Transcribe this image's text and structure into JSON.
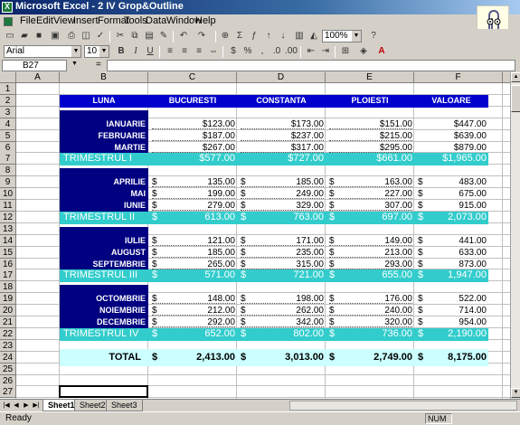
{
  "window": {
    "title": "Microsoft Excel - 2 IV Grop&Outline"
  },
  "menu": [
    "File",
    "Edit",
    "View",
    "Insert",
    "Format",
    "Tools",
    "Data",
    "Window",
    "Help"
  ],
  "toolbar": {
    "zoom": "100%",
    "font": "Arial",
    "size": "10"
  },
  "formula": {
    "namebox": "B27",
    "value": ""
  },
  "columns": [
    "A",
    "B",
    "C",
    "D",
    "E",
    "F",
    "G"
  ],
  "rows": [
    "1",
    "2",
    "3",
    "4",
    "5",
    "6",
    "7",
    "8",
    "9",
    "10",
    "11",
    "12",
    "13",
    "14",
    "15",
    "16",
    "17",
    "18",
    "19",
    "20",
    "21",
    "22",
    "23",
    "24",
    "25",
    "26",
    "27"
  ],
  "header": {
    "luna": "LUNA",
    "c": "BUCURESTI",
    "d": "CONSTANTA",
    "e": "PLOIESTI",
    "f": "VALOARE"
  },
  "q1": {
    "months": [
      {
        "name": "IANUARIE",
        "c": "$123.00",
        "d": "$173.00",
        "e": "$151.00",
        "f": "$447.00"
      },
      {
        "name": "FEBRUARIE",
        "c": "$187.00",
        "d": "$237.00",
        "e": "$215.00",
        "f": "$639.00"
      },
      {
        "name": "MARTIE",
        "c": "$267.00",
        "d": "$317.00",
        "e": "$295.00",
        "f": "$879.00"
      }
    ],
    "label": "TRIMESTRUL  I",
    "c": "$577.00",
    "d": "$727.00",
    "e": "$661.00",
    "f": "$1,965.00"
  },
  "q2": {
    "months": [
      {
        "name": "APRILIE",
        "c": "135.00",
        "d": "185.00",
        "e": "163.00",
        "f": "483.00"
      },
      {
        "name": "MAI",
        "c": "199.00",
        "d": "249.00",
        "e": "227.00",
        "f": "675.00"
      },
      {
        "name": "IUNIE",
        "c": "279.00",
        "d": "329.00",
        "e": "307.00",
        "f": "915.00"
      }
    ],
    "label": "TRIMESTRUL  II",
    "c": "613.00",
    "d": "763.00",
    "e": "697.00",
    "f": "2,073.00"
  },
  "q3": {
    "months": [
      {
        "name": "IULIE",
        "c": "121.00",
        "d": "171.00",
        "e": "149.00",
        "f": "441.00"
      },
      {
        "name": "AUGUST",
        "c": "185.00",
        "d": "235.00",
        "e": "213.00",
        "f": "633.00"
      },
      {
        "name": "SEPTEMBRIE",
        "c": "265.00",
        "d": "315.00",
        "e": "293.00",
        "f": "873.00"
      }
    ],
    "label": "TRIMESTRUL  III",
    "c": "571.00",
    "d": "721.00",
    "e": "655.00",
    "f": "1,947.00"
  },
  "q4": {
    "months": [
      {
        "name": "OCTOMBRIE",
        "c": "148.00",
        "d": "198.00",
        "e": "176.00",
        "f": "522.00"
      },
      {
        "name": "NOIEMBRIE",
        "c": "212.00",
        "d": "262.00",
        "e": "240.00",
        "f": "714.00"
      },
      {
        "name": "DECEMBRIE",
        "c": "292.00",
        "d": "342.00",
        "e": "320.00",
        "f": "954.00"
      }
    ],
    "label": "TRIMESTRUL  IV",
    "c": "652.00",
    "d": "802.00",
    "e": "736.00",
    "f": "2,190.00"
  },
  "total": {
    "label": "TOTAL",
    "c": "2,413.00",
    "d": "3,013.00",
    "e": "2,749.00",
    "f": "8,175.00"
  },
  "currency": "$",
  "sheets": [
    "Sheet1",
    "Sheet2",
    "Sheet3"
  ],
  "status": {
    "text": "Ready",
    "num": "NUM"
  }
}
